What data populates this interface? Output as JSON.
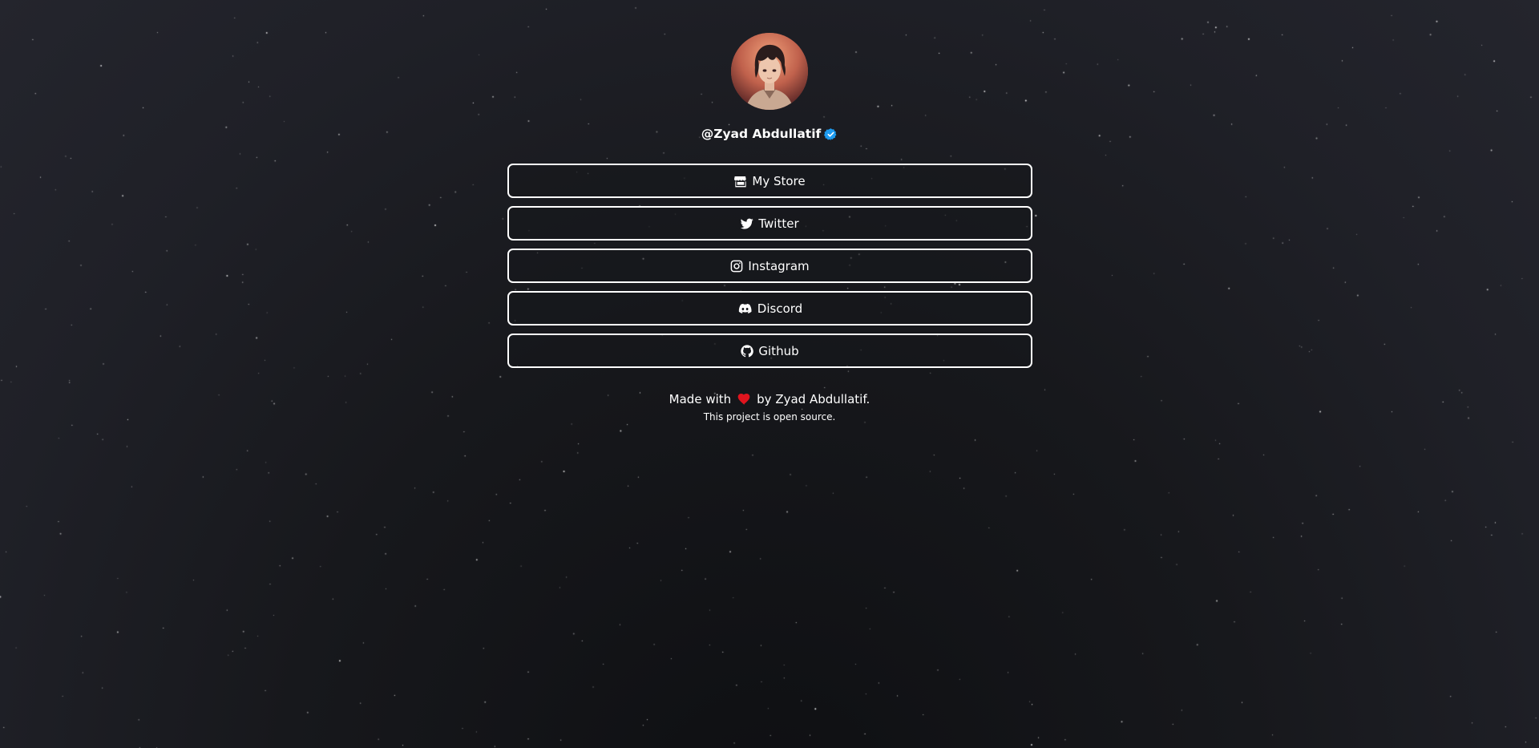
{
  "profile": {
    "username": "@Zyad Abdullatif",
    "verified": true,
    "verified_color": "#1d9bf0"
  },
  "links": [
    {
      "label": "My Store",
      "icon": "store-icon"
    },
    {
      "label": "Twitter",
      "icon": "twitter-icon"
    },
    {
      "label": "Instagram",
      "icon": "instagram-icon"
    },
    {
      "label": "Discord",
      "icon": "discord-icon"
    },
    {
      "label": "Github",
      "icon": "github-icon"
    }
  ],
  "footer": {
    "made_with": "Made with",
    "by": "by Zyad Abdullatif.",
    "open_source": "This project is open source.",
    "heart_color": "#e0141e"
  },
  "theme": {
    "background": "#1f2027",
    "text": "#ffffff",
    "button_border": "#ffffff"
  }
}
